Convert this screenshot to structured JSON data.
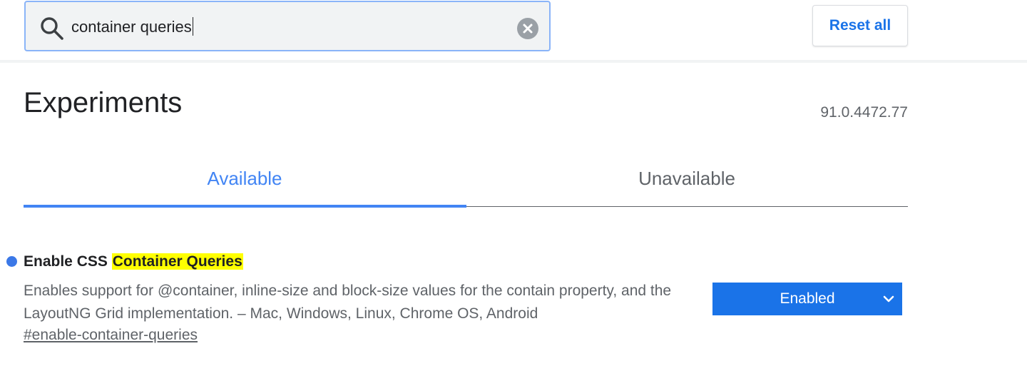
{
  "search": {
    "value": "container queries",
    "icon": "search-icon",
    "clear_icon": "clear-icon"
  },
  "reset_label": "Reset all",
  "page": {
    "title": "Experiments",
    "version": "91.0.4472.77"
  },
  "tabs": [
    {
      "label": "Available",
      "active": true
    },
    {
      "label": "Unavailable",
      "active": false
    }
  ],
  "experiment": {
    "title_prefix": "Enable CSS ",
    "title_highlight": "Container Queries",
    "description": "Enables support for @container, inline-size and block-size values for the contain property, and the LayoutNG Grid implementation. – Mac, Windows, Linux, Chrome OS, Android",
    "link": "#enable-container-queries",
    "selected_option": "Enabled",
    "modified": true
  },
  "colors": {
    "accent": "#1a73e8",
    "tab_active": "#4285f4",
    "highlight": "#ffff00",
    "modified_dot": "#3b78e7"
  }
}
